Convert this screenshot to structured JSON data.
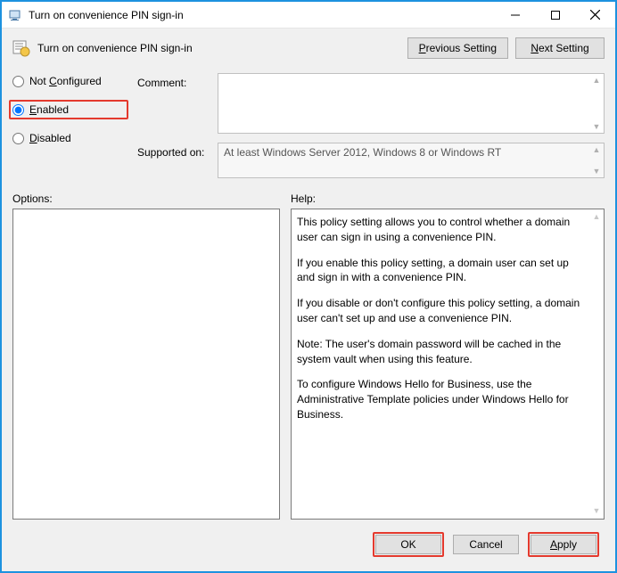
{
  "window": {
    "title": "Turn on convenience PIN sign-in"
  },
  "header": {
    "policy_name": "Turn on convenience PIN sign-in",
    "prev_label_pre": "",
    "prev_u": "P",
    "prev_label_post": "revious Setting",
    "next_label_pre": "",
    "next_u": "N",
    "next_label_post": "ext Setting"
  },
  "radios": {
    "not_configured_pre": "Not ",
    "not_configured_u": "C",
    "not_configured_post": "onfigured",
    "enabled_u": "E",
    "enabled_post": "nabled",
    "disabled_u": "D",
    "disabled_post": "isabled",
    "selected": "enabled"
  },
  "labels": {
    "comment": "Comment:",
    "supported": "Supported on:",
    "options": "Options:",
    "help": "Help:"
  },
  "comment_value": "",
  "supported_text": "At least Windows Server 2012, Windows 8 or Windows RT",
  "help": {
    "p1": "This policy setting allows you to control whether a domain user can sign in using a convenience PIN.",
    "p2": "If you enable this policy setting, a domain user can set up and sign in with a convenience PIN.",
    "p3": "If you disable or don't configure this policy setting, a domain user can't set up and use a convenience PIN.",
    "p4": "Note: The user's domain password will be cached in the system vault when using this feature.",
    "p5": "To configure Windows Hello for Business, use the Administrative Template policies under Windows Hello for Business."
  },
  "footer": {
    "ok": "OK",
    "cancel": "Cancel",
    "apply_u": "A",
    "apply_post": "pply"
  }
}
